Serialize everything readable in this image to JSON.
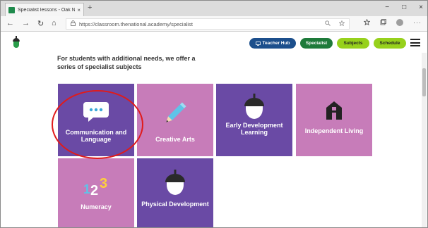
{
  "browser": {
    "tab_title": "Specialist lessons - Oak National",
    "tab_close": "×",
    "new_tab": "+",
    "window_controls": [
      "−",
      "□",
      "×"
    ],
    "url": "https://classroom.thenational.academy/specialist",
    "nav": {
      "back": "←",
      "forward": "→",
      "refresh": "↻",
      "home": "⌂"
    }
  },
  "header": {
    "logo": "oak-acorn-logo",
    "nav_pills": [
      {
        "label": "Teacher Hub",
        "color": "#1c4f8c"
      },
      {
        "label": "Specialist",
        "color": "#1e7a3a"
      },
      {
        "label": "Subjects",
        "color": "#97d11c"
      },
      {
        "label": "Schedule",
        "color": "#97d11c"
      }
    ],
    "menu_icon": "hamburger-menu-icon"
  },
  "intro": {
    "text": "For students with additional needs, we offer a series of specialist subjects"
  },
  "tiles": [
    {
      "label": "Communication and Language",
      "icon": "speech-bubble-icon",
      "color": "#6a4aa5",
      "highlighted": true
    },
    {
      "label": "Creative Arts",
      "icon": "pencil-icon",
      "color": "#c77cb9"
    },
    {
      "label": "Early Development Learning",
      "icon": "acorn-icon",
      "color": "#6a4aa5"
    },
    {
      "label": "Independent Living",
      "icon": "house-icon",
      "color": "#c77cb9"
    },
    {
      "label": "Numeracy",
      "icon": "numbers-123-icon",
      "color": "#c77cb9"
    },
    {
      "label": "Physical Development",
      "icon": "acorn-icon",
      "color": "#6a4aa5"
    }
  ],
  "highlight_color": "#e01b1b"
}
